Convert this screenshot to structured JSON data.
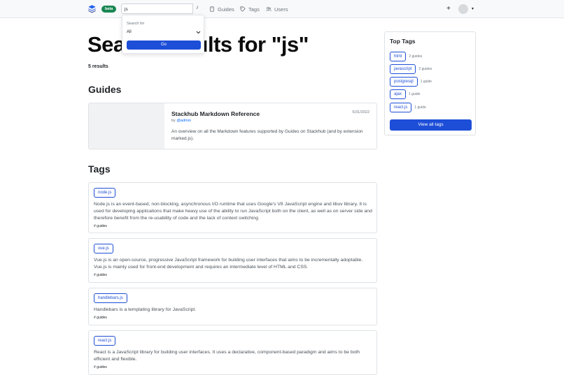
{
  "navbar": {
    "beta_badge": "beta",
    "search": {
      "value": "js",
      "shortcut": "/"
    },
    "links": [
      {
        "label": "Guides",
        "icon": "book-icon"
      },
      {
        "label": "Tags",
        "icon": "tag-icon"
      },
      {
        "label": "Users",
        "icon": "users-icon"
      }
    ],
    "plus": "+",
    "avatar_caret": "▾"
  },
  "dropdown": {
    "label": "Search for",
    "selected": "All",
    "go_label": "Go"
  },
  "main": {
    "title": "Search results for \"js\"",
    "results_count": "5 results",
    "guides_heading": "Guides",
    "tags_heading": "Tags"
  },
  "guides": [
    {
      "title": "Stackhub Markdown Reference",
      "date": "5/31/2022",
      "by": "by ",
      "author": "@admin",
      "description": "An overview on all the Markdown features supported by Guides on Stackhub (and by extension marked.js)."
    }
  ],
  "tags": [
    {
      "name": "node.js",
      "description": "Node.js is an event-based, non-blocking, asynchronous I/O runtime that uses Google's V8 JavaScript engine and libuv library. It is used for developing applications that make heavy use of the ability to run JavaScript both on the client, as well as on server side and therefore benefit from the re-usability of code and the lack of context switching",
      "meta": "# guides"
    },
    {
      "name": "vue.js",
      "description": "Vue.js is an open-source, progressive JavaScript framework for building user interfaces that aims to be incrementally adoptable. Vue.js is mainly used for front-end development and requires an intermediate level of HTML and CSS.",
      "meta": "# guides"
    },
    {
      "name": "handlebars.js",
      "description": "Handlebars is a templating library for JavaScript.",
      "meta": "# guides"
    },
    {
      "name": "react.js",
      "description": "React is a JavaScript library for building user interfaces. It uses a declarative, component-based paradigm and aims to be both efficient and flexible.",
      "meta": "# guides"
    }
  ],
  "sidebar": {
    "title": "Top Tags",
    "tags": [
      {
        "name": "html",
        "count": "2 guides"
      },
      {
        "name": "javascript",
        "count": "2 guides"
      },
      {
        "name": "postgresql",
        "count": "1 guide"
      },
      {
        "name": "ajax",
        "count": "1 guide"
      },
      {
        "name": "react.js",
        "count": "1 guide"
      }
    ],
    "view_all": "View all tags"
  },
  "colors": {
    "accent": "#1d4ed8",
    "beta": "#198754",
    "link": "#0d6efd"
  }
}
